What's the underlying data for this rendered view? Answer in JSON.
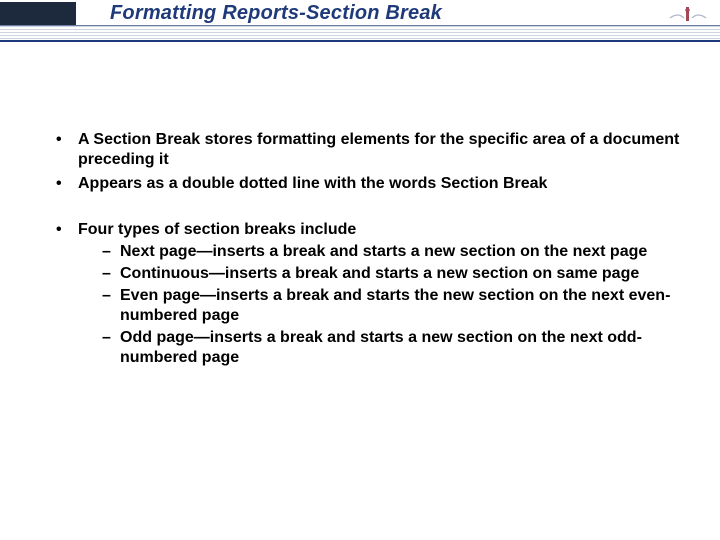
{
  "header": {
    "title": "Formatting Reports-Section Break"
  },
  "group1": [
    "A Section Break stores formatting elements for the specific area of a document preceding it",
    "Appears as a double dotted line with the words Section Break"
  ],
  "group2_lead": "Four types of section breaks include",
  "group2_items": [
    "Next page—inserts a break and starts a new section on the next page",
    "Continuous—inserts a break and starts a new section on same page",
    "Even page—inserts  a break and starts the new section on the next even-numbered page",
    "Odd page—inserts a break and starts a new section on the next odd-numbered page"
  ]
}
